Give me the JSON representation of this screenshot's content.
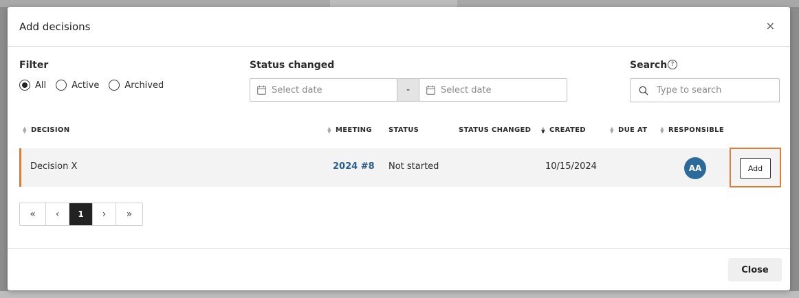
{
  "dialog": {
    "title": "Add decisions",
    "close_symbol": "×"
  },
  "filter": {
    "label": "Filter",
    "options": [
      {
        "label": "All",
        "selected": true
      },
      {
        "label": "Active",
        "selected": false
      },
      {
        "label": "Archived",
        "selected": false
      }
    ]
  },
  "status_changed": {
    "label": "Status changed",
    "from_placeholder": "Select date",
    "to_placeholder": "Select date",
    "separator": "-"
  },
  "search": {
    "label": "Search",
    "help_symbol": "?",
    "placeholder": "Type to search"
  },
  "table": {
    "columns": {
      "decision": "DECISION",
      "meeting": "MEETING",
      "status": "STATUS",
      "status_changed": "STATUS CHANGED",
      "created": "CREATED",
      "due_at": "DUE AT",
      "responsible": "RESPONSIBLE"
    },
    "rows": [
      {
        "decision": "Decision X",
        "meeting": "2024 #8",
        "status": "Not started",
        "status_changed": "",
        "created": "10/15/2024",
        "due_at": "",
        "responsible_initials": "AA",
        "action_label": "Add"
      }
    ]
  },
  "pagination": {
    "first": "«",
    "prev": "‹",
    "current_page": "1",
    "next": "›",
    "last": "»"
  },
  "footer": {
    "close_label": "Close"
  },
  "colors": {
    "accent": "#e07b39",
    "link": "#2b5f8f",
    "avatar": "#2c6a9a"
  }
}
